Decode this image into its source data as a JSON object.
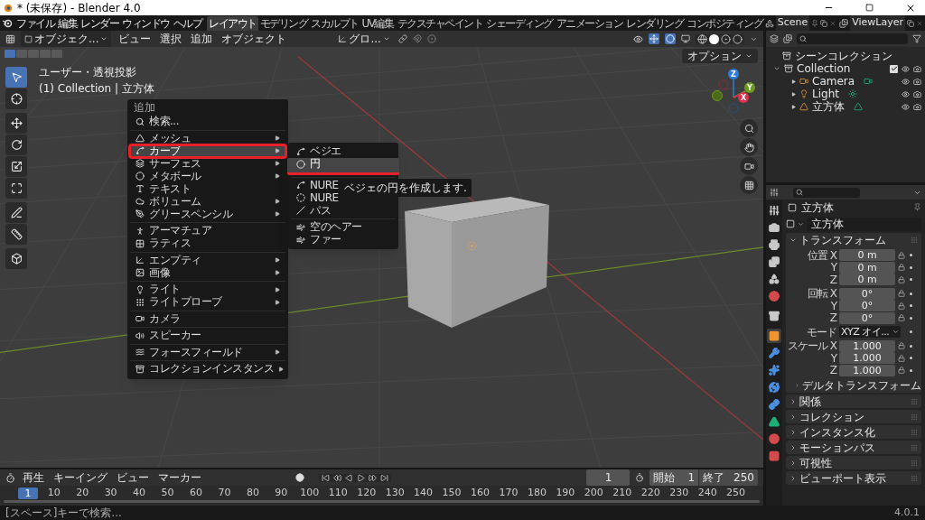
{
  "window": {
    "title": "* (未保存) - Blender 4.0"
  },
  "menu_bar": [
    "ファイル",
    "編集",
    "レンダー",
    "ウィンドウ",
    "ヘルプ"
  ],
  "workspace_tabs": [
    {
      "label": "レイアウト",
      "selected": true
    },
    {
      "label": "モデリング",
      "selected": false
    },
    {
      "label": "スカルプト",
      "selected": false
    },
    {
      "label": "UV編集",
      "selected": false
    },
    {
      "label": "テクスチャペイント",
      "selected": false
    },
    {
      "label": "シェーディング",
      "selected": false
    },
    {
      "label": "アニメーション",
      "selected": false
    },
    {
      "label": "レンダリング",
      "selected": false
    },
    {
      "label": "コンポジティング",
      "selected": false
    }
  ],
  "scene": "Scene",
  "view_layer": "ViewLayer",
  "viewport_header": {
    "mode": "オブジェク...",
    "menus": [
      "ビュー",
      "選択",
      "追加",
      "オブジェクト"
    ],
    "orientation": "グロ..."
  },
  "viewport": {
    "options": "オプション",
    "view_name": "ユーザー・透視投影",
    "collection_info": "(1) Collection | 立方体",
    "gizmo_axes": [
      {
        "label": "Z",
        "color": "#2f7cd8"
      },
      {
        "label": "Y",
        "color": "#6b9a1f"
      },
      {
        "label": "X",
        "color": "#e0304c"
      }
    ]
  },
  "tools": [
    {
      "kind": "select",
      "selected": true
    },
    {
      "kind": "cursor",
      "selected": false
    },
    {
      "kind": "move",
      "selected": false
    },
    {
      "kind": "rotate",
      "selected": false
    },
    {
      "kind": "scale",
      "selected": false
    },
    {
      "kind": "transform",
      "selected": false
    },
    {
      "kind": "annotate",
      "selected": false
    },
    {
      "kind": "measure",
      "selected": false
    },
    {
      "kind": "add_cube",
      "selected": false
    }
  ],
  "add_menu": {
    "title": "追加",
    "sections": [
      [
        {
          "kind": "search",
          "label": "検索...",
          "submenu": false,
          "selected": false,
          "marked": false
        }
      ],
      [
        {
          "kind": "mesh",
          "label": "メッシュ",
          "submenu": true,
          "selected": false,
          "marked": false
        },
        {
          "kind": "curve",
          "label": "カーブ",
          "submenu": true,
          "selected": true,
          "marked": true
        },
        {
          "kind": "surface",
          "label": "サーフェス",
          "submenu": true,
          "selected": false,
          "marked": false
        },
        {
          "kind": "metaball",
          "label": "メタボール",
          "submenu": true,
          "selected": false,
          "marked": false
        },
        {
          "kind": "text",
          "label": "テキスト",
          "submenu": false,
          "selected": false,
          "marked": false
        },
        {
          "kind": "volume",
          "label": "ボリューム",
          "submenu": true,
          "selected": false,
          "marked": false
        },
        {
          "kind": "grease_pencil",
          "label": "グリースペンシル",
          "submenu": true,
          "selected": false,
          "marked": false
        }
      ],
      [
        {
          "kind": "armature",
          "label": "アーマチュア",
          "submenu": false,
          "selected": false,
          "marked": false
        },
        {
          "kind": "lattice",
          "label": "ラティス",
          "submenu": false,
          "selected": false,
          "marked": false
        }
      ],
      [
        {
          "kind": "empty",
          "label": "エンプティ",
          "submenu": true,
          "selected": false,
          "marked": false
        },
        {
          "kind": "image",
          "label": "画像",
          "submenu": true,
          "selected": false,
          "marked": false
        }
      ],
      [
        {
          "kind": "light",
          "label": "ライト",
          "submenu": true,
          "selected": false,
          "marked": false
        },
        {
          "kind": "light_probe",
          "label": "ライトプローブ",
          "submenu": true,
          "selected": false,
          "marked": false
        }
      ],
      [
        {
          "kind": "camera",
          "label": "カメラ",
          "submenu": false,
          "selected": false,
          "marked": false
        }
      ],
      [
        {
          "kind": "speaker",
          "label": "スピーカー",
          "submenu": false,
          "selected": false,
          "marked": false
        }
      ],
      [
        {
          "kind": "force_field",
          "label": "フォースフィールド",
          "submenu": true,
          "selected": false,
          "marked": false
        }
      ],
      [
        {
          "kind": "collection_instance",
          "label": "コレクションインスタンス",
          "submenu": true,
          "selected": false,
          "marked": false
        }
      ]
    ]
  },
  "curve_submenu": {
    "sections": [
      [
        {
          "kind": "bezier",
          "label": "ベジエ",
          "selected": false,
          "marked": false
        },
        {
          "kind": "circle",
          "label": "円",
          "selected": true,
          "marked": true
        }
      ],
      [
        {
          "kind": "nurbs_curve",
          "label": "NURE",
          "selected": false,
          "marked": false
        },
        {
          "kind": "nurbs_circle",
          "label": "NURE",
          "selected": false,
          "marked": false
        },
        {
          "kind": "path",
          "label": "パス",
          "selected": false,
          "marked": false
        }
      ],
      [
        {
          "kind": "hair",
          "label": "空のヘアー",
          "selected": false,
          "marked": false
        },
        {
          "kind": "hair",
          "label": "ファー",
          "selected": false,
          "marked": false
        }
      ]
    ]
  },
  "tooltip": "ベジェの円を作成します.",
  "outliner": {
    "scene_collection": "シーンコレクション",
    "tree": [
      {
        "kind": "collection",
        "label": "Collection",
        "expanded": true,
        "checked": true,
        "children": [
          {
            "kind": "camera",
            "label": "Camera",
            "expanded": false
          },
          {
            "kind": "light",
            "label": "Light",
            "expanded": false
          },
          {
            "kind": "mesh",
            "label": "立方体",
            "expanded": false
          }
        ]
      }
    ]
  },
  "properties": {
    "tabs": [
      {
        "kind": "tool",
        "selected": false,
        "color": "#c8c8c8"
      },
      {
        "kind": "render",
        "selected": false,
        "color": "#c8c8c8"
      },
      {
        "kind": "output",
        "selected": false,
        "color": "#c8c8c8"
      },
      {
        "kind": "view_layer",
        "selected": false,
        "color": "#c8c8c8"
      },
      {
        "kind": "scene",
        "selected": false,
        "color": "#c8c8c8"
      },
      {
        "kind": "world",
        "selected": false,
        "color": "#d24b4b"
      },
      {
        "kind": "collection",
        "selected": false,
        "color": "#c8c8c8"
      },
      {
        "kind": "object",
        "selected": true,
        "color": "#f0932b"
      },
      {
        "kind": "modifier",
        "selected": false,
        "color": "#4b8fe0"
      },
      {
        "kind": "particles",
        "selected": false,
        "color": "#4b8fe0"
      },
      {
        "kind": "physics",
        "selected": false,
        "color": "#4b8fe0"
      },
      {
        "kind": "constraints",
        "selected": false,
        "color": "#4b8fe0"
      },
      {
        "kind": "data",
        "selected": false,
        "color": "#1fb07a"
      },
      {
        "kind": "material",
        "selected": false,
        "color": "#d24b4b"
      },
      {
        "kind": "texture",
        "selected": false,
        "color": "#d24b4b"
      }
    ],
    "object_name": "立方体",
    "name_field": "立方体",
    "transform": {
      "title": "トランスフォーム",
      "expanded": true,
      "groups": [
        {
          "rows": [
            {
              "kind": "number",
              "label": "位置 X",
              "value": "0 m"
            },
            {
              "kind": "number",
              "label": "Y",
              "value": "0 m"
            },
            {
              "kind": "number",
              "label": "Z",
              "value": "0 m"
            }
          ]
        },
        {
          "rows": [
            {
              "kind": "number",
              "label": "回転 X",
              "value": "0°"
            },
            {
              "kind": "number",
              "label": "Y",
              "value": "0°"
            },
            {
              "kind": "number",
              "label": "Z",
              "value": "0°"
            }
          ]
        },
        {
          "rows": [
            {
              "kind": "dropdown",
              "label": "モード",
              "value": "XYZ オイ..."
            }
          ]
        },
        {
          "rows": [
            {
              "kind": "number",
              "label": "スケール X",
              "value": "1.000"
            },
            {
              "kind": "number",
              "label": "Y",
              "value": "1.000"
            },
            {
              "kind": "number",
              "label": "Z",
              "value": "1.000"
            }
          ]
        }
      ],
      "subpanel": "デルタトランスフォーム"
    },
    "panels": [
      "関係",
      "コレクション",
      "インスタンス化",
      "モーションパス",
      "可視性",
      "ビューポート表示"
    ]
  },
  "timeline": {
    "menus": [
      "再生",
      "キーイング",
      "ビュー",
      "マーカー"
    ],
    "current_frame": "1",
    "start_label": "開始",
    "start": "1",
    "end_label": "終了",
    "end": "250",
    "ticks": [
      "1",
      "10",
      "20",
      "30",
      "40",
      "50",
      "60",
      "70",
      "80",
      "90",
      "100",
      "110",
      "120",
      "130",
      "140",
      "150",
      "160",
      "170",
      "180",
      "190",
      "200",
      "210",
      "220",
      "230",
      "240",
      "250"
    ]
  },
  "status_bar": {
    "hint": "[スペース]キーで検索...",
    "version": "4.0.1"
  }
}
